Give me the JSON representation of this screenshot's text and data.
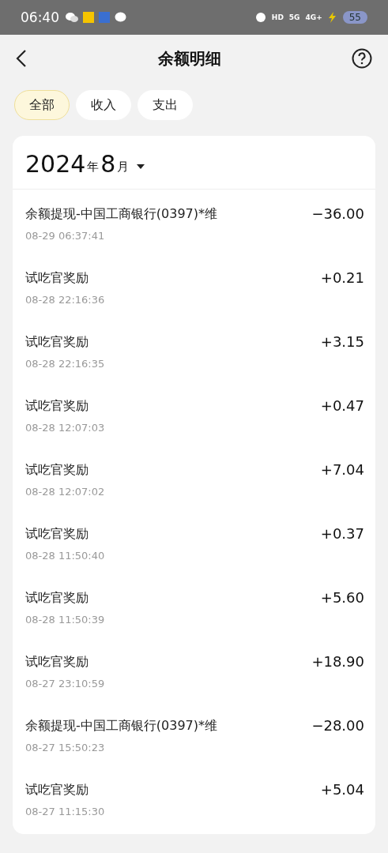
{
  "status_bar": {
    "time": "06:40",
    "network": [
      "HD",
      "5G",
      "4G+"
    ],
    "battery": "55"
  },
  "header": {
    "title": "余额明细"
  },
  "filters": [
    {
      "label": "全部",
      "selected": true
    },
    {
      "label": "收入",
      "selected": false
    },
    {
      "label": "支出",
      "selected": false
    }
  ],
  "month": {
    "year": "2024",
    "year_unit": "年",
    "month": "8",
    "month_unit": "月"
  },
  "transactions": [
    {
      "title": "余额提现-中国工商银行(0397)*维",
      "time": "08-29 06:37:41",
      "amount": "−36.00"
    },
    {
      "title": "试吃官奖励",
      "time": "08-28 22:16:36",
      "amount": "+0.21"
    },
    {
      "title": "试吃官奖励",
      "time": "08-28 22:16:35",
      "amount": "+3.15"
    },
    {
      "title": "试吃官奖励",
      "time": "08-28 12:07:03",
      "amount": "+0.47"
    },
    {
      "title": "试吃官奖励",
      "time": "08-28 12:07:02",
      "amount": "+7.04"
    },
    {
      "title": "试吃官奖励",
      "time": "08-28 11:50:40",
      "amount": "+0.37"
    },
    {
      "title": "试吃官奖励",
      "time": "08-28 11:50:39",
      "amount": "+5.60"
    },
    {
      "title": "试吃官奖励",
      "time": "08-27 23:10:59",
      "amount": "+18.90"
    },
    {
      "title": "余额提现-中国工商银行(0397)*维",
      "time": "08-27 15:50:23",
      "amount": "−28.00"
    },
    {
      "title": "试吃官奖励",
      "time": "08-27 11:15:30",
      "amount": "+5.04"
    }
  ]
}
